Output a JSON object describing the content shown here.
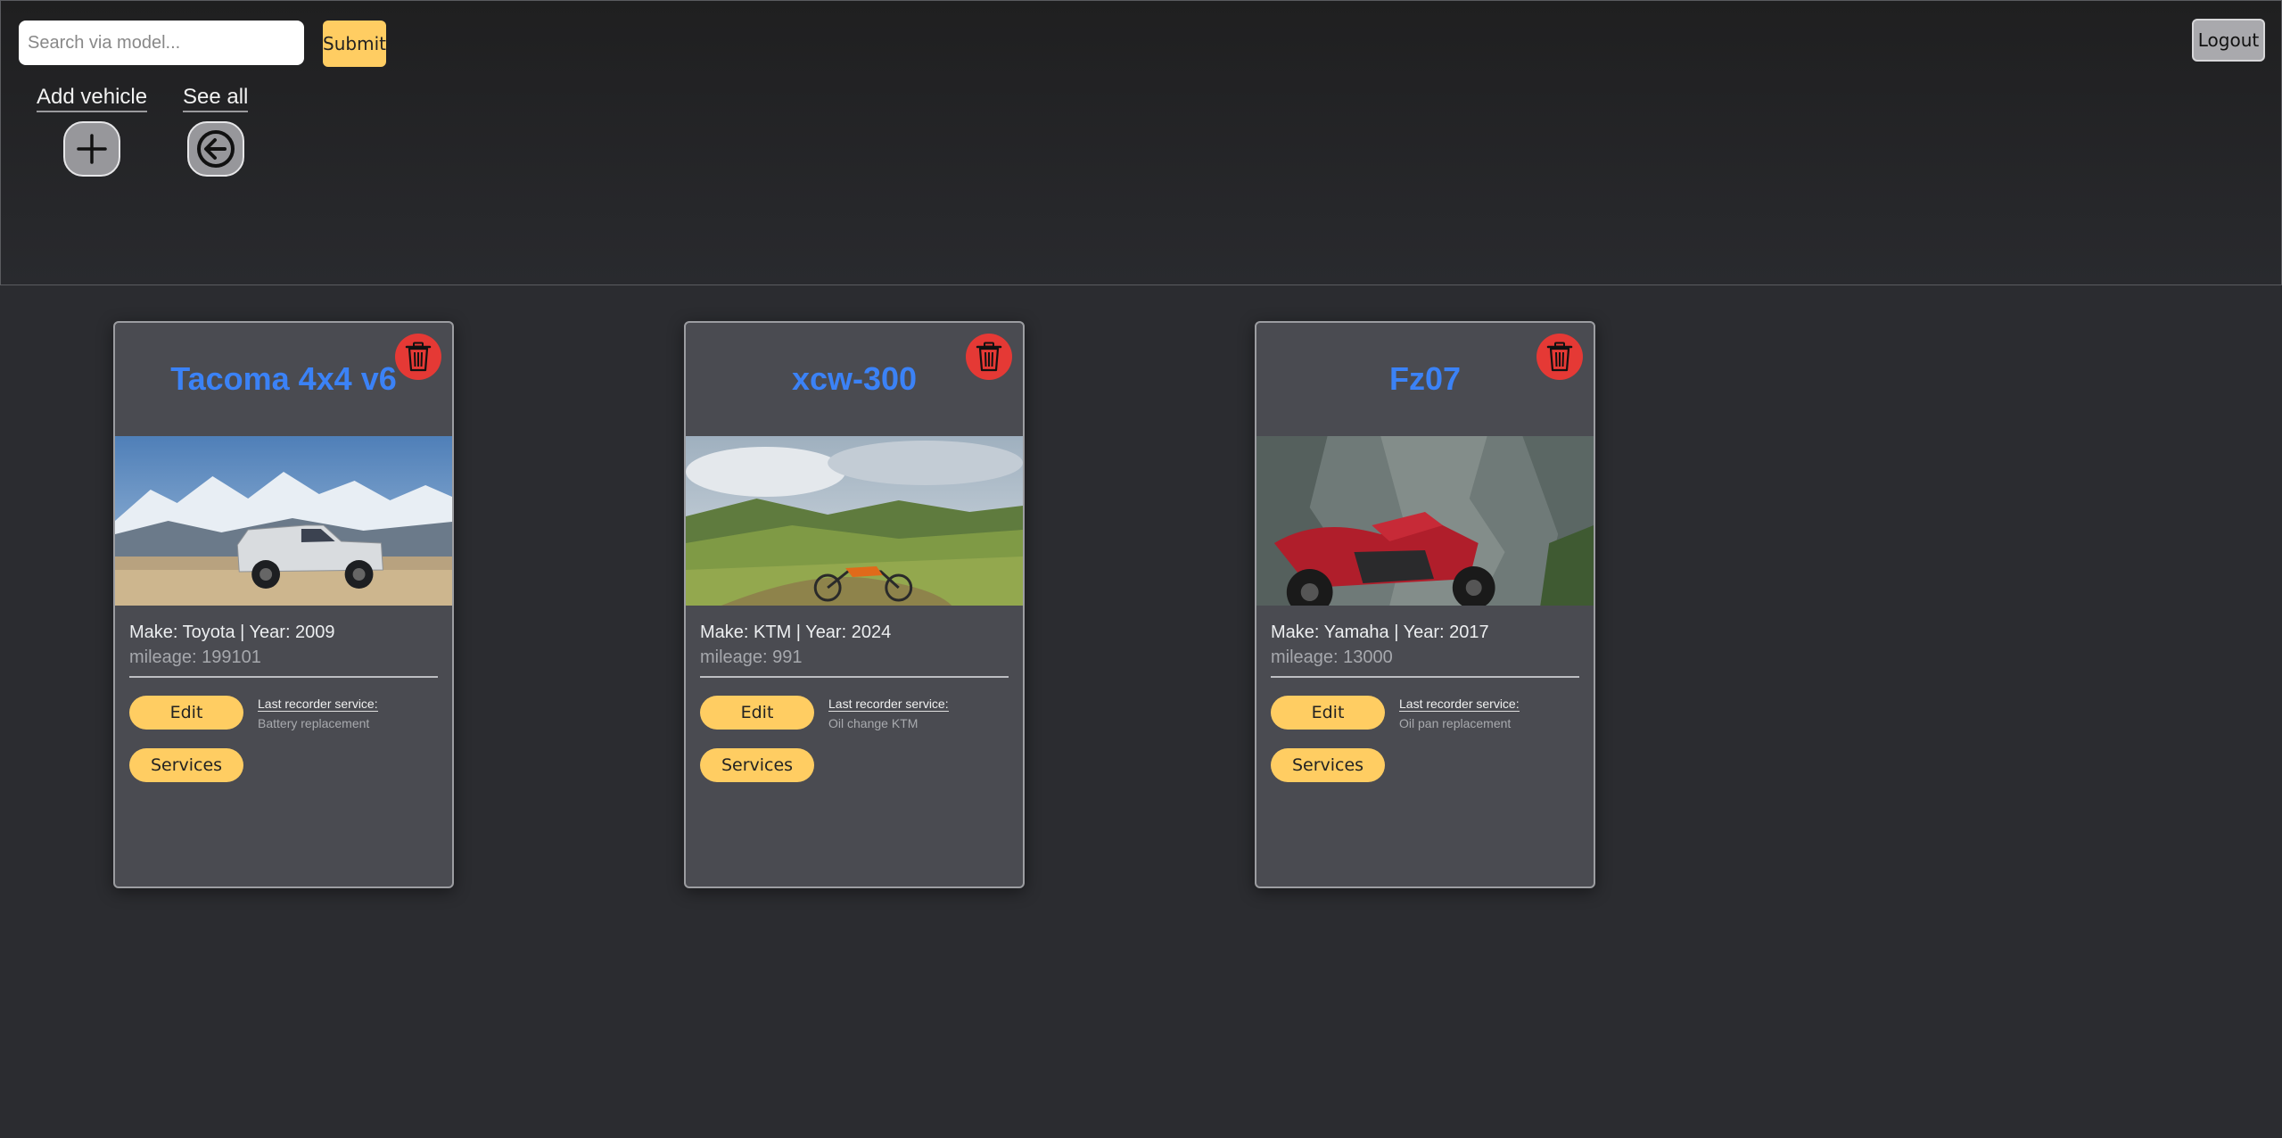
{
  "header": {
    "search": {
      "placeholder": "Search via model...",
      "value": ""
    },
    "submit_label": "Submit",
    "logout_label": "Logout",
    "add_vehicle_label": "Add vehicle",
    "see_all_label": "See all"
  },
  "vehicles": [
    {
      "title": "Tacoma 4x4 v6",
      "make_year": "Make: Toyota | Year: 2009",
      "mileage": "mileage: 199101",
      "edit_label": "Edit",
      "services_label": "Services",
      "last_service_label": "Last recorder service:",
      "last_service": "Battery replacement",
      "photo": "silver-pickup-truck-mountains"
    },
    {
      "title": "xcw-300",
      "make_year": "Make: KTM | Year: 2024",
      "mileage": "mileage: 991",
      "edit_label": "Edit",
      "services_label": "Services",
      "last_service_label": "Last recorder service:",
      "last_service": "Oil change KTM",
      "photo": "dirt-bike-green-meadow"
    },
    {
      "title": "Fz07",
      "make_year": "Make: Yamaha | Year: 2017",
      "mileage": "mileage: 13000",
      "edit_label": "Edit",
      "services_label": "Services",
      "last_service_label": "Last recorder service:",
      "last_service": "Oil pan replacement",
      "photo": "red-motorcycle-canyon"
    }
  ],
  "colors": {
    "accent_yellow": "#ffcd62",
    "title_blue": "#3b82f6",
    "delete_red": "#e53935",
    "background": "#2b2c30",
    "card": "#4a4b51"
  },
  "icons": {
    "add": "plus-icon",
    "see_all": "arrow-left-circle-icon",
    "delete": "trash-icon"
  }
}
